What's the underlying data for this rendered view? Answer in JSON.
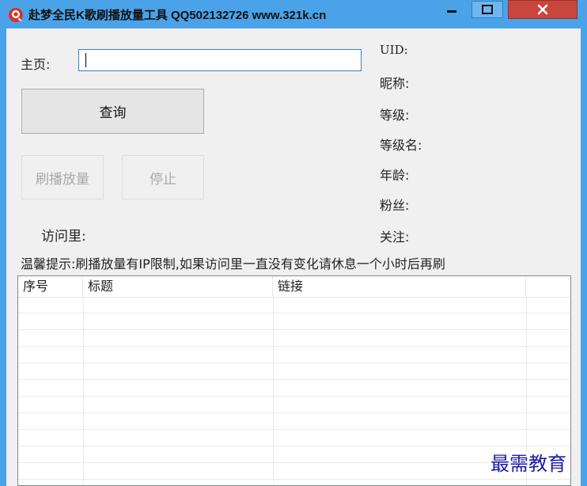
{
  "window": {
    "title": "赴梦全民K歌刷播放量工具 QQ502132726  www.321k.cn",
    "minimize_symbol": "−",
    "maximize_symbol": "☐",
    "close_symbol": "✕"
  },
  "form": {
    "homepage_label": "主页:",
    "homepage_value": "",
    "query_button": "查询",
    "brush_button": "刷播放量",
    "stop_button": "停止",
    "visits_label": "访问里:"
  },
  "profile": {
    "uid_label": "UID:",
    "nickname_label": "昵称:",
    "level_label": "等级:",
    "level_name_label": "等级名:",
    "age_label": "年龄:",
    "fans_label": "粉丝:",
    "following_label": "关注:"
  },
  "tip": "温馨提示:刷播放量有IP限制,如果访问里一直没有变化请休息一个小时后再刷",
  "table": {
    "columns": [
      "序号",
      "标题",
      "链接",
      ""
    ],
    "rows": []
  },
  "watermark": "最需教育",
  "colors": {
    "titlebar": "#4aa3e8",
    "close_button": "#c9463d",
    "client_bg": "#f0f0f0",
    "input_border": "#3c7fd1",
    "watermark": "#1a1aa8"
  },
  "icons": {
    "app": "music-app-icon"
  }
}
